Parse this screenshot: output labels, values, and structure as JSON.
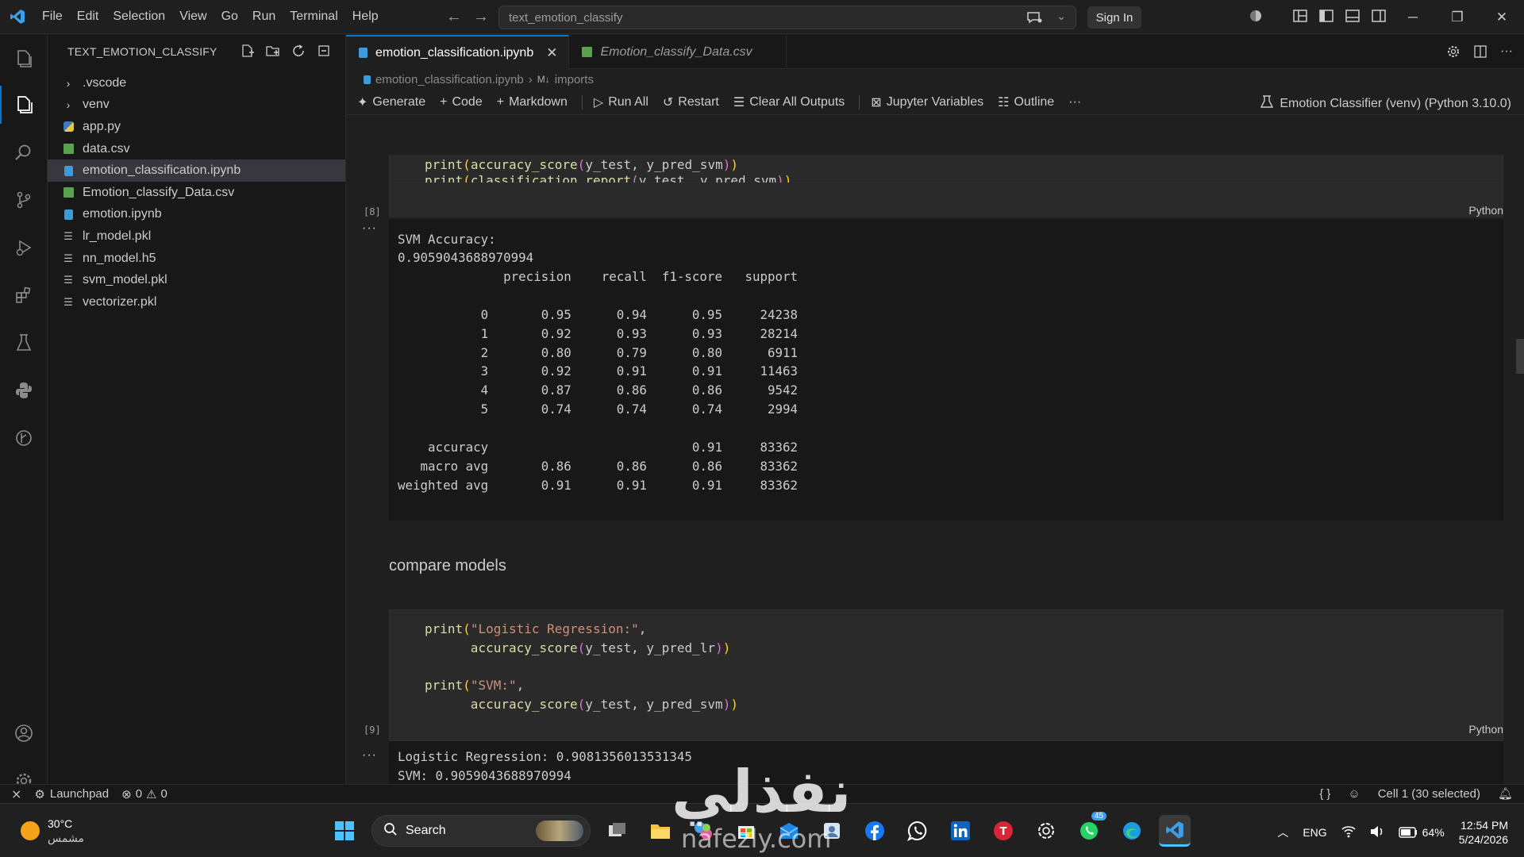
{
  "titlebar": {
    "menu": [
      "File",
      "Edit",
      "Selection",
      "View",
      "Go",
      "Run",
      "Terminal",
      "Help"
    ],
    "search_text": "text_emotion_classify",
    "sign_in": "Sign In"
  },
  "sidebar": {
    "title": "TEXT_EMOTION_CLASSIFY",
    "items": [
      {
        "label": ".vscode",
        "kind": "folder"
      },
      {
        "label": "venv",
        "kind": "folder"
      },
      {
        "label": "app.py",
        "kind": "python"
      },
      {
        "label": "data.csv",
        "kind": "csv"
      },
      {
        "label": "emotion_classification.ipynb",
        "kind": "notebook"
      },
      {
        "label": "Emotion_classify_Data.csv",
        "kind": "csv"
      },
      {
        "label": "emotion.ipynb",
        "kind": "notebook"
      },
      {
        "label": "lr_model.pkl",
        "kind": "file"
      },
      {
        "label": "nn_model.h5",
        "kind": "file"
      },
      {
        "label": "svm_model.pkl",
        "kind": "file"
      },
      {
        "label": "vectorizer.pkl",
        "kind": "file"
      }
    ]
  },
  "tabs": [
    {
      "label": "emotion_classification.ipynb",
      "active": true
    },
    {
      "label": "Emotion_classify_Data.csv",
      "active": false
    }
  ],
  "breadcrumb": {
    "file": "emotion_classification.ipynb",
    "section": "imports"
  },
  "toolbar": {
    "generate": "Generate",
    "code": "Code",
    "markdown": "Markdown",
    "run_all": "Run All",
    "restart": "Restart",
    "clear_outputs": "Clear All Outputs",
    "variables": "Jupyter Variables",
    "outline": "Outline",
    "more": "···",
    "kernel": "Emotion Classifier (venv) (Python 3.10.0)"
  },
  "cell8": {
    "lines": [
      "print(accuracy_score(y_test, y_pred_svm))",
      "print(classification_report(y_test, y_pred_svm))"
    ],
    "exec_count": "[8]",
    "language": "Python",
    "output": [
      "SVM Accuracy:",
      "0.9059043688970994",
      "              precision    recall  f1-score   support",
      "",
      "           0       0.95      0.94      0.95     24238",
      "           1       0.92      0.93      0.93     28214",
      "           2       0.80      0.79      0.80      6911",
      "           3       0.92      0.91      0.91     11463",
      "           4       0.87      0.86      0.86      9542",
      "           5       0.74      0.74      0.74      2994",
      "",
      "    accuracy                           0.91     83362",
      "   macro avg       0.86      0.86      0.86     83362",
      "weighted avg       0.91      0.91      0.91     83362"
    ]
  },
  "markdown_cell": "compare models",
  "cell9": {
    "exec_count": "[9]",
    "language": "Python",
    "code": {
      "l1_fn": "print",
      "l1_str": "\"Logistic Regression:\"",
      "l2": "accuracy_score(y_test, y_pred_lr)",
      "l3_fn": "print",
      "l3_str": "\"SVM:\"",
      "l4": "accuracy_score(y_test, y_pred_svm)"
    },
    "output": [
      "Logistic Regression: 0.9081356013531345",
      "SVM: 0.9059043688970994"
    ]
  },
  "statusbar": {
    "launchpad": "Launchpad",
    "errors": "0",
    "warnings": "0",
    "cell_info": "Cell 1 (30 selected)"
  },
  "taskbar": {
    "temperature": "30°C",
    "weather": "مشمس",
    "search": "Search",
    "lang": "ENG",
    "battery": "64%",
    "time": "12:54 PM",
    "date": "5/24/2026",
    "whatsapp_badge": "45"
  },
  "watermark": {
    "arabic": "نفذلي",
    "latin": "nafezly.com"
  },
  "colors": {
    "accent": "#0078d4",
    "string": "#ce9178",
    "function": "#dcdcaa"
  }
}
